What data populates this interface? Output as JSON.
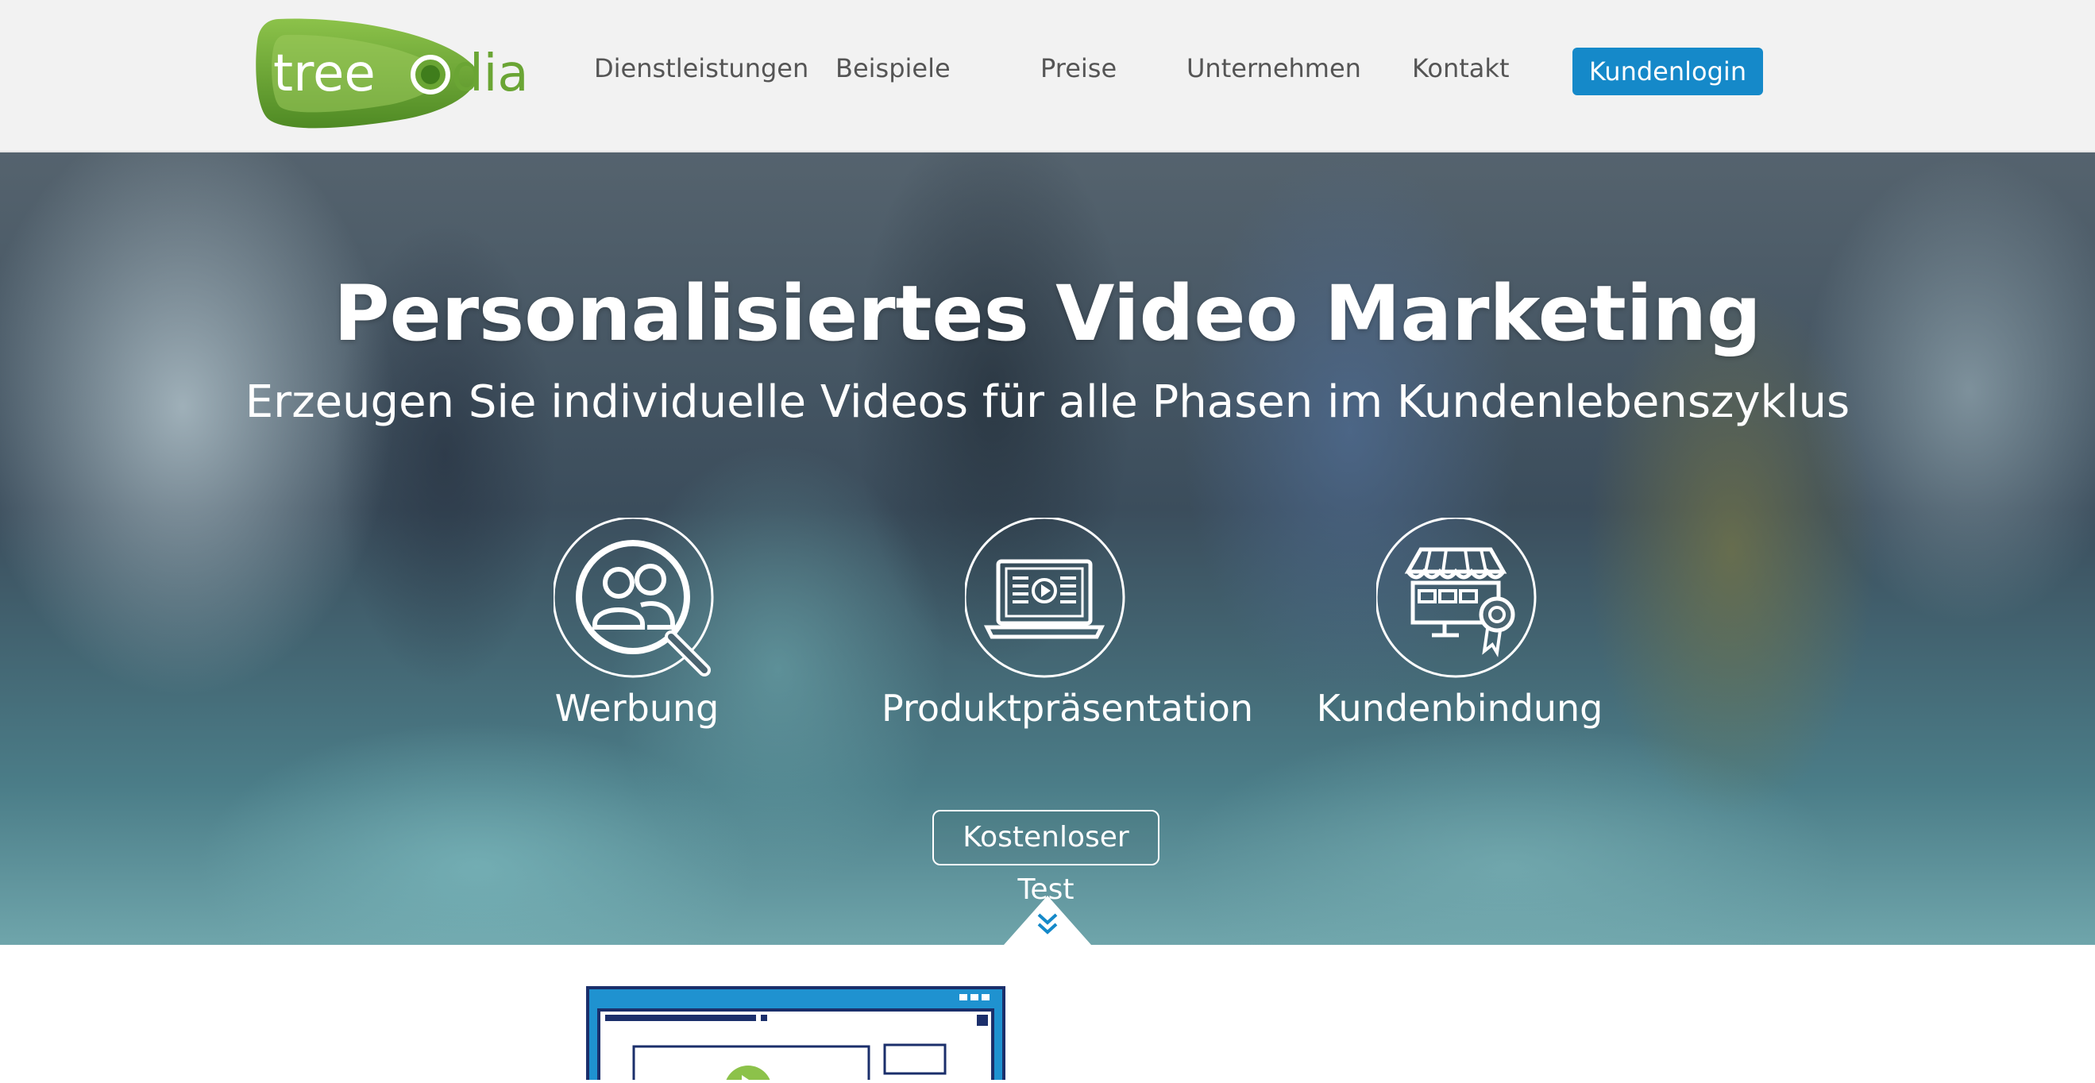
{
  "header": {
    "logo_text": "treepodia",
    "nav": [
      {
        "label": "Dienstleistungen"
      },
      {
        "label": "Beispiele"
      },
      {
        "label": "Preise"
      },
      {
        "label": "Unternehmen"
      },
      {
        "label": "Kontakt"
      }
    ],
    "login_label": "Kundenlogin"
  },
  "hero": {
    "title": "Personalisiertes Video Marketing",
    "subtitle": "Erzeugen Sie individuelle Videos für alle Phasen im Kundenlebenszyklus",
    "features": [
      {
        "label": "Werbung",
        "icon": "people-search-icon"
      },
      {
        "label": "Produktpräsentation",
        "icon": "laptop-video-icon"
      },
      {
        "label": "Kundenbindung",
        "icon": "storefront-badge-icon"
      }
    ],
    "cta_label": "Kostenloser Test",
    "scroll_icon": "double-chevron-down-icon"
  },
  "colors": {
    "accent": "#1589c9",
    "logo_green": "#6aa534",
    "header_bg": "#f2f2f2"
  }
}
